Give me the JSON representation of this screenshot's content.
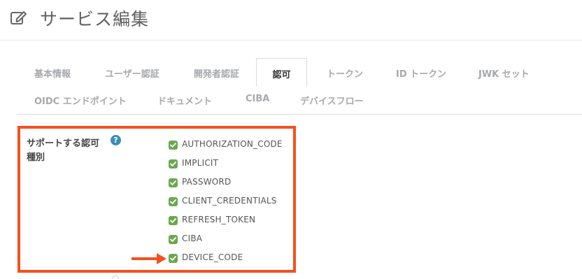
{
  "page": {
    "title": "サービス編集",
    "icon": "edit-icon"
  },
  "tabs": [
    {
      "label": "基本情報",
      "active": false
    },
    {
      "label": "ユーザー認証",
      "active": false
    },
    {
      "label": "開発者認証",
      "active": false
    },
    {
      "label": "認可",
      "active": true
    },
    {
      "label": "トークン",
      "active": false
    },
    {
      "label": "ID トークン",
      "active": false
    },
    {
      "label": "JWK セット",
      "active": false
    },
    {
      "label": "OIDC エンドポイント",
      "active": false
    },
    {
      "label": "ドキュメント",
      "active": false
    },
    {
      "label": "CIBA",
      "active": false
    },
    {
      "label": "デバイスフロー",
      "active": false
    }
  ],
  "grant_types": {
    "label_line1": "サポートする認可",
    "label_line2": "種別",
    "help_icon": "?",
    "items": [
      {
        "label": "AUTHORIZATION_CODE",
        "checked": true
      },
      {
        "label": "IMPLICIT",
        "checked": true
      },
      {
        "label": "PASSWORD",
        "checked": true
      },
      {
        "label": "CLIENT_CREDENTIALS",
        "checked": true
      },
      {
        "label": "REFRESH_TOKEN",
        "checked": true
      },
      {
        "label": "CIBA",
        "checked": true
      },
      {
        "label": "DEVICE_CODE",
        "checked": true
      }
    ]
  },
  "colors": {
    "highlight": "#f4511e",
    "checkbox": "#6aa84f",
    "help": "#3c8dbc"
  }
}
